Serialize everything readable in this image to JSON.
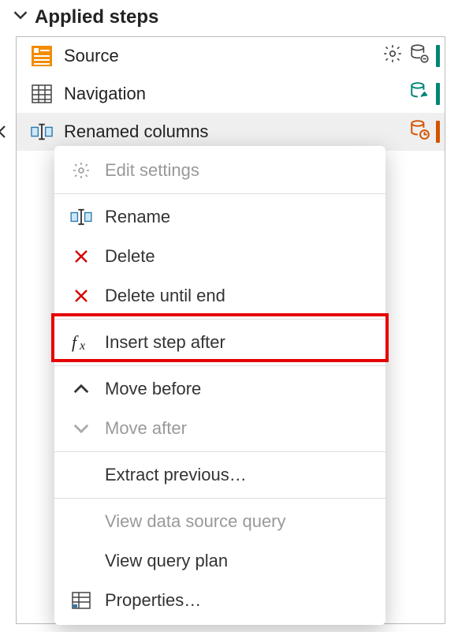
{
  "panel": {
    "title": "Applied steps"
  },
  "steps": [
    {
      "label": "Source"
    },
    {
      "label": "Navigation"
    },
    {
      "label": "Renamed columns"
    }
  ],
  "accent_colors": {
    "teal": "#008577",
    "orange": "#d35400"
  },
  "menu": {
    "edit_settings": "Edit settings",
    "rename": "Rename",
    "delete": "Delete",
    "delete_until_end": "Delete until end",
    "insert_step_after": "Insert step after",
    "move_before": "Move before",
    "move_after": "Move after",
    "extract_previous": "Extract previous…",
    "view_data_source_query": "View data source query",
    "view_query_plan": "View query plan",
    "properties": "Properties…"
  }
}
